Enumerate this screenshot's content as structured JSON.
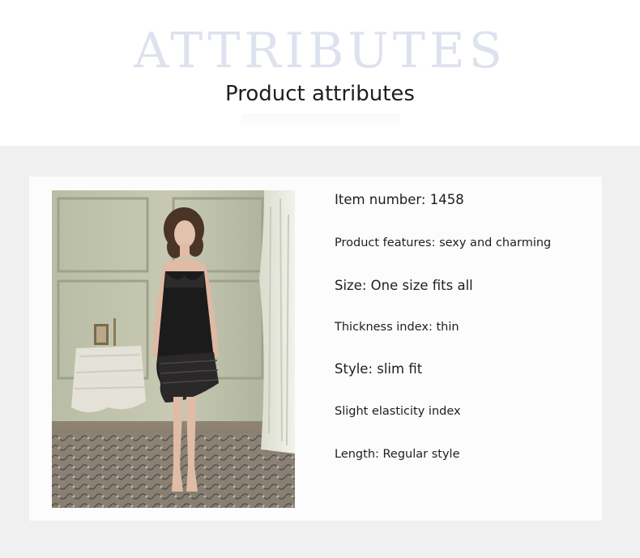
{
  "header": {
    "watermark": "ATTRIBUTES",
    "title": "Product attributes"
  },
  "attributes": [
    {
      "text": "Item number: 1458",
      "size": "big"
    },
    {
      "text": "Product features: sexy and charming",
      "size": "small"
    },
    {
      "text": "Size: One size fits all",
      "size": "big"
    },
    {
      "text": "Thickness index: thin",
      "size": "small"
    },
    {
      "text": "Style: slim fit",
      "size": "big"
    },
    {
      "text": "Slight elasticity index",
      "size": "small"
    },
    {
      "text": "Length: Regular style",
      "size": "small"
    }
  ],
  "colors": {
    "watermark": "#dde2ee",
    "title": "#1e1e1e",
    "band": "#f0f0f0",
    "card": "#fcfcfc"
  }
}
